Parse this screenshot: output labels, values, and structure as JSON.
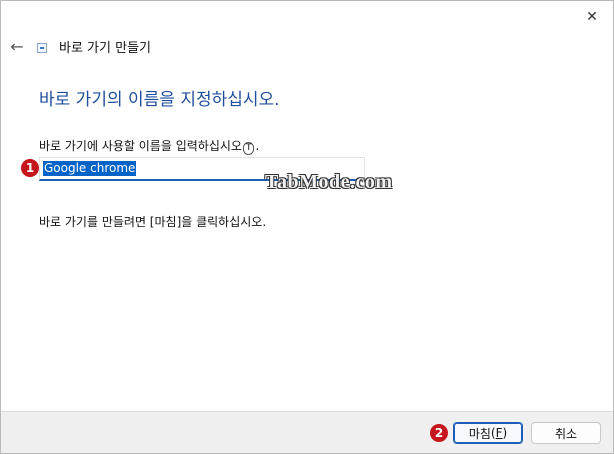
{
  "window": {
    "title": "바로 가기 만들기"
  },
  "icons": {
    "close": "close-icon",
    "back": "back-arrow-icon",
    "wizard": "shortcut-wizard-icon"
  },
  "heading": "바로 가기의 이름을 지정하십시오.",
  "prompt": {
    "text": "바로 가기에 사용할 이름을 입력하십시오",
    "access_key": "T",
    "suffix": "."
  },
  "name_field": {
    "value": "Google chrome"
  },
  "instruction": "바로 가기를 만들려면 [마침]을 클릭하십시오.",
  "watermark": "TabMode.com",
  "steps": {
    "one": "1",
    "two": "2"
  },
  "buttons": {
    "finish": {
      "label": "마침",
      "access_key": "F"
    },
    "cancel": {
      "label": "취소"
    }
  },
  "colors": {
    "heading": "#1f4e9c",
    "selection": "#0063c8",
    "badge": "#c4161c"
  }
}
